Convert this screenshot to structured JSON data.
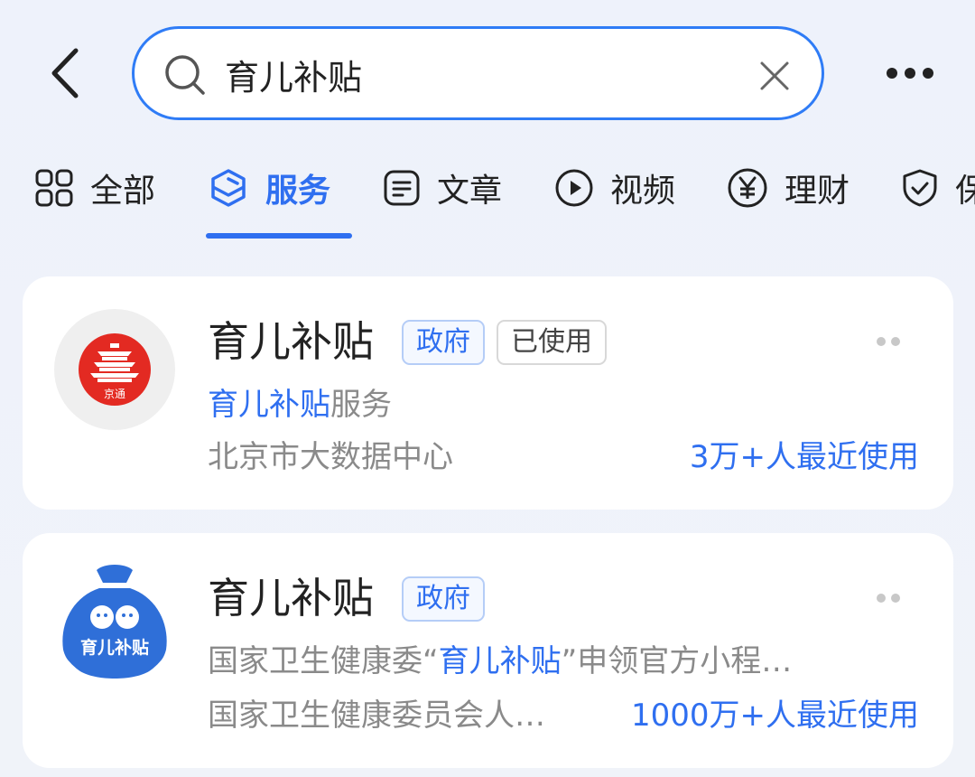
{
  "search": {
    "query": "育儿补贴"
  },
  "tabs": [
    {
      "label": "全部",
      "icon": "grid-icon",
      "active": false
    },
    {
      "label": "服务",
      "icon": "layers-icon",
      "active": true
    },
    {
      "label": "文章",
      "icon": "document-icon",
      "active": false
    },
    {
      "label": "视频",
      "icon": "play-icon",
      "active": false
    },
    {
      "label": "理财",
      "icon": "yen-icon",
      "active": false
    },
    {
      "label": "保",
      "icon": "shield-icon",
      "active": false
    }
  ],
  "results": [
    {
      "logo": "jingtong-logo",
      "logo_text": "京通",
      "title": "育儿补贴",
      "badges": [
        "政府",
        "已使用"
      ],
      "desc_highlight": "育儿补贴",
      "desc_rest": "服务",
      "provider": "北京市大数据中心",
      "usage": "3万+人最近使用"
    },
    {
      "logo": "childcare-subsidy-logo",
      "logo_text": "育儿补贴",
      "title": "育儿补贴",
      "badges": [
        "政府"
      ],
      "desc_prefix": "国家卫生健康委“",
      "desc_highlight": "育儿补贴",
      "desc_suffix": "”申领官方小程…",
      "provider": "国家卫生健康委员会人…",
      "usage": "1000万+人最近使用"
    }
  ],
  "colors": {
    "accent": "#2f6ff0",
    "logo_red": "#e32a22",
    "logo_blue": "#2f6fd8"
  }
}
